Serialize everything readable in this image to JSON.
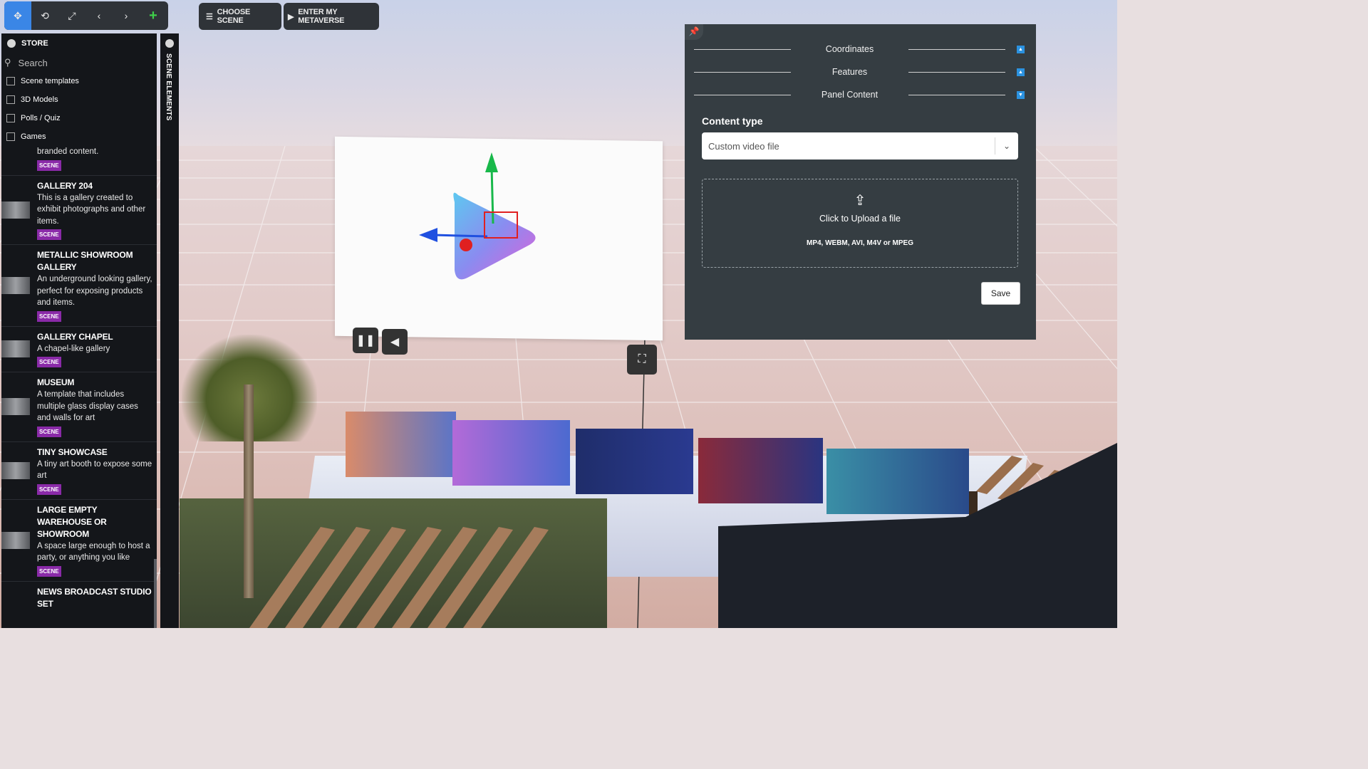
{
  "toolbar": {
    "tools": [
      "move-icon",
      "rotate-icon",
      "scale-icon",
      "undo-icon",
      "redo-icon",
      "add-icon"
    ],
    "choose_scene": "CHOOSE SCENE",
    "enter_metaverse": "ENTER MY METAVERSE"
  },
  "store": {
    "title": "STORE",
    "search_placeholder": "Search",
    "filters": [
      "Scene templates",
      "3D Models",
      "Polls / Quiz",
      "Games"
    ],
    "items": [
      {
        "title": "",
        "desc": "branded content.",
        "badge": "SCENE"
      },
      {
        "title": "GALLERY 204",
        "desc": "This is a gallery created to exhibit photographs and other items.",
        "badge": "SCENE"
      },
      {
        "title": "METALLIC SHOWROOM GALLERY",
        "desc": "An underground looking gallery, perfect for exposing products and items.",
        "badge": "SCENE"
      },
      {
        "title": "GALLERY CHAPEL",
        "desc": "A chapel-like gallery",
        "badge": "SCENE"
      },
      {
        "title": "MUSEUM",
        "desc": "A template that includes multiple glass display cases and walls for art",
        "badge": "SCENE"
      },
      {
        "title": "TINY SHOWCASE",
        "desc": "A tiny art booth to expose some art",
        "badge": "SCENE"
      },
      {
        "title": "LARGE EMPTY WAREHOUSE OR SHOWROOM",
        "desc": "A space large enough to host a party, or anything you like",
        "badge": "SCENE"
      },
      {
        "title": "NEWS BROADCAST STUDIO SET",
        "desc": "",
        "badge": ""
      }
    ]
  },
  "scene_elements": {
    "label": "SCENE ELEMENTS"
  },
  "panel": {
    "sections": [
      {
        "label": "Coordinates",
        "state": "collapsed"
      },
      {
        "label": "Features",
        "state": "collapsed"
      },
      {
        "label": "Panel Content",
        "state": "expanded"
      }
    ],
    "content_type_label": "Content type",
    "content_type_value": "Custom video file",
    "upload_text": "Click to Upload a file",
    "upload_formats": "MP4, WEBM, AVI, M4V or MPEG",
    "save_label": "Save"
  },
  "colors": {
    "accent": "#3a86e6",
    "add": "#3fcf4a",
    "badge": "#8a2aa8",
    "panel_bg": "#353d42",
    "sidebar_bg": "#14161a"
  }
}
